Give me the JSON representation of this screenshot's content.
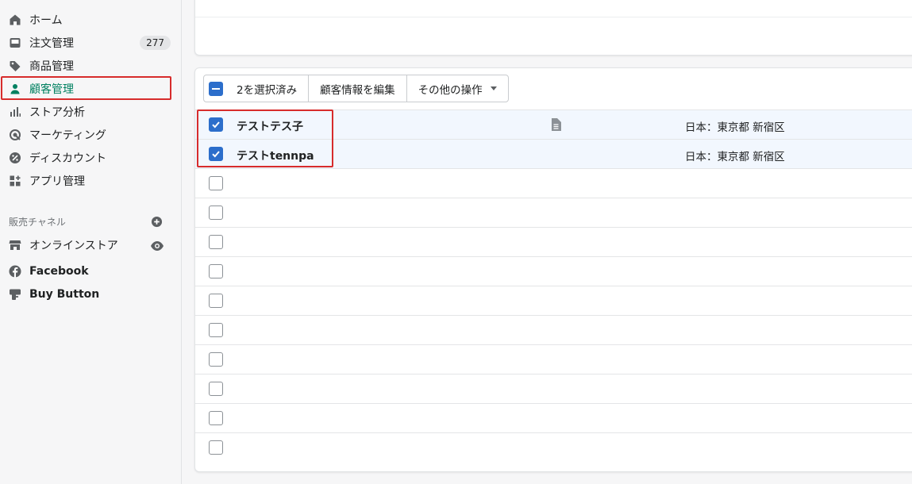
{
  "sidebar": {
    "items": [
      {
        "label": "ホーム",
        "icon": "home-icon"
      },
      {
        "label": "注文管理",
        "icon": "inbox-icon",
        "badge": "277"
      },
      {
        "label": "商品管理",
        "icon": "tag-icon"
      },
      {
        "label": "顧客管理",
        "icon": "person-icon",
        "active": true
      },
      {
        "label": "ストア分析",
        "icon": "bar-chart-icon"
      },
      {
        "label": "マーケティング",
        "icon": "target-icon"
      },
      {
        "label": "ディスカウント",
        "icon": "discount-icon"
      },
      {
        "label": "アプリ管理",
        "icon": "apps-icon"
      }
    ],
    "channels_label": "販売チャネル",
    "channels": [
      {
        "label": "オンラインストア",
        "icon": "store-icon"
      },
      {
        "label": "Facebook",
        "icon": "facebook-icon"
      },
      {
        "label": "Buy Button",
        "icon": "buy-button-icon"
      }
    ]
  },
  "bulk_actions": {
    "selected_label": "2を選択済み",
    "edit_label": "顧客情報を編集",
    "more_label": "その他の操作"
  },
  "customers": [
    {
      "name": "テストテス子",
      "location": "日本：東京都 新宿区",
      "has_note": true,
      "checked": true
    },
    {
      "name": "テストtennpa",
      "location": "日本：東京都 新宿区",
      "has_note": false,
      "checked": true
    }
  ],
  "colors": {
    "accent_green": "#008060",
    "checkbox_blue": "#2c6ecb",
    "highlight_red": "#d72c2c"
  }
}
